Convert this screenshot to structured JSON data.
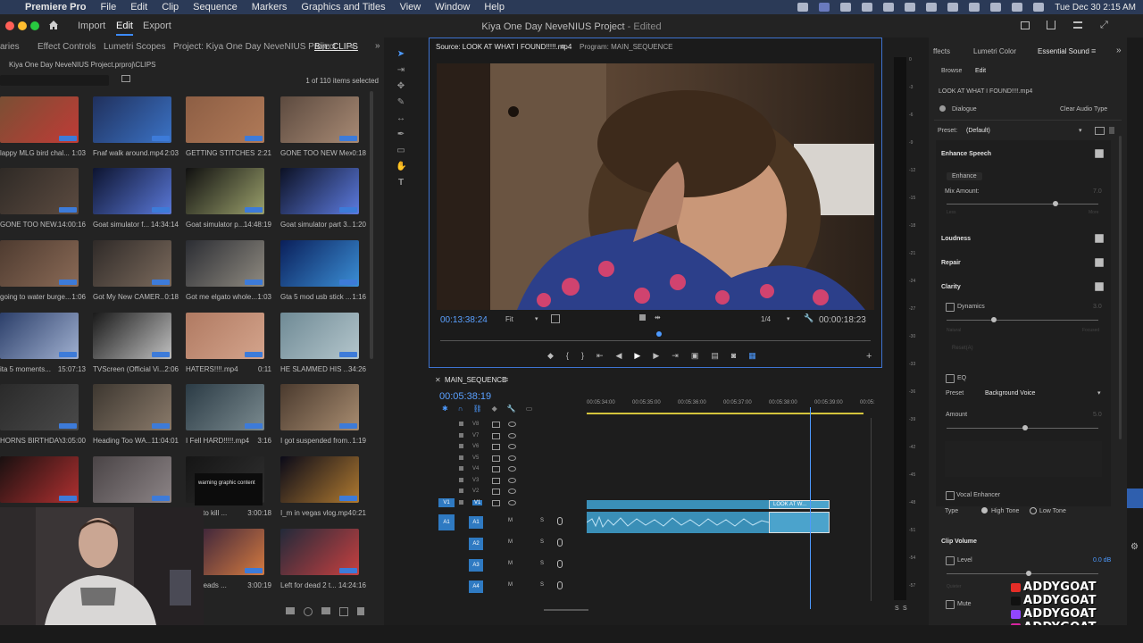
{
  "menubar": {
    "apple": "",
    "app_name": "Premiere Pro",
    "items": [
      "File",
      "Edit",
      "Clip",
      "Sequence",
      "Markers",
      "Graphics and Titles",
      "View",
      "Window",
      "Help"
    ],
    "clock": "Tue Dec 30  2:15 AM"
  },
  "header": {
    "tabs": [
      "Import",
      "Edit",
      "Export"
    ],
    "active_tab": "Edit",
    "project_title": "Kiya One Day NeveNIUS Project",
    "status": " - Edited"
  },
  "project_panel": {
    "tabs": [
      "aries",
      "Effect Controls",
      "Lumetri Scopes",
      "Project: Kiya One Day NeveNIUS Project",
      "Bin: CLIPS"
    ],
    "path": "Kiya One Day NeveNIUS Project.prproj\\CLIPS",
    "selection": "1 of 110 items selected",
    "clips": [
      {
        "name": "lappy MLG bird chal...",
        "dur": "1:03"
      },
      {
        "name": "Fnaf walk around.mp4",
        "dur": "2:03"
      },
      {
        "name": "GETTING STITCHES ...",
        "dur": "2:21"
      },
      {
        "name": "GONE TOO NEW Mex...",
        "dur": "0:18"
      },
      {
        "name": "GONE TOO NEW...",
        "dur": "14:00:16"
      },
      {
        "name": "Goat simulator f...",
        "dur": "14:34:14"
      },
      {
        "name": "Goat simulator p...",
        "dur": "14:48:19"
      },
      {
        "name": "Goat simulator part 3...",
        "dur": "1:20"
      },
      {
        "name": "going to water burge...",
        "dur": "1:06"
      },
      {
        "name": "Got My New CAMER...",
        "dur": "0:18"
      },
      {
        "name": "Got me elgato whole...",
        "dur": "1:03"
      },
      {
        "name": "Gta 5 mod usb stick ...",
        "dur": "1:16"
      },
      {
        "name": "ita 5 moments...",
        "dur": "15:07:13"
      },
      {
        "name": "TVScreen (Official Vi...",
        "dur": "2:06"
      },
      {
        "name": "HATERS!!!!.mp4",
        "dur": "0:11"
      },
      {
        "name": "HE SLAMMED HIS ...",
        "dur": "34:26"
      },
      {
        "name": "HORNS BIRTHDAY...",
        "dur": "3:05:00"
      },
      {
        "name": "Heading Too WA...",
        "dur": "11:04:01"
      },
      {
        "name": "I Fell HARD!!!!!.mp4",
        "dur": "3:16"
      },
      {
        "name": "I got suspended from...",
        "dur": "1:19"
      },
      {
        "name": "",
        "dur": ""
      },
      {
        "name": "",
        "dur": ""
      },
      {
        "name": "joing to kill ...",
        "dur": "3:00:18"
      },
      {
        "name": "I_m in vegas vlog.mp4",
        "dur": "0:21"
      },
      {
        "name": "",
        "dur": ""
      },
      {
        "name": "",
        "dur": ""
      },
      {
        "name": "gas heads ...",
        "dur": "3:00:19"
      },
      {
        "name": "Left for dead 2 t...",
        "dur": "14:24:16"
      }
    ],
    "warning_text": "warning graphic content"
  },
  "monitor": {
    "source_tab": "Source: LOOK AT WHAT I FOUND!!!!!.mp4",
    "program_tab": "Program: MAIN_SEQUENCE",
    "timecode_in": "00:13:38:24",
    "fit": "Fit",
    "resolution": "1/4",
    "duration": "00:00:18:23"
  },
  "timeline": {
    "sequence_name": "MAIN_SEQUENCE",
    "playhead": "00:05:38:19",
    "ruler": [
      "00:05:34:00",
      "00:05:35:00",
      "00:05:36:00",
      "00:05:37:00",
      "00:05:38:00",
      "00:05:39:00",
      "00:05:"
    ],
    "video_tracks": [
      "V8",
      "V7",
      "V6",
      "V5",
      "V4",
      "V3",
      "V2",
      "V1"
    ],
    "audio_tracks": [
      "A1",
      "A2",
      "A3",
      "A4"
    ],
    "source_v": "V1",
    "source_a": "A1",
    "clip_label": "LOOK AT W..."
  },
  "essential_sound": {
    "tabs": [
      "ffects",
      "Lumetri Color",
      "Essential Sound"
    ],
    "subtabs": [
      "Browse",
      "Edit"
    ],
    "clip_name": "LOOK AT WHAT I FOUND!!!!.mp4",
    "type": "Dialogue",
    "clear_button": "Clear Audio Type",
    "preset_label": "Preset:",
    "preset_value": "(Default)",
    "enhance_speech": "Enhance Speech",
    "enhance_button": "Enhance",
    "mix_amount": "Mix Amount:",
    "mix_value": "7.0",
    "less": "Less",
    "more": "More",
    "loudness": "Loudness",
    "repair": "Repair",
    "clarity": "Clarity",
    "dynamics": "Dynamics",
    "dynamics_value": "3.0",
    "natural": "Natural",
    "focused": "Focused",
    "reset": "Reset(A)",
    "eq": "EQ",
    "eq_preset_label": "Preset",
    "eq_preset_value": "Background Voice",
    "amount": "Amount",
    "amount_value": "5.0",
    "vocal_enhancer": "Vocal Enhancer",
    "type_label": "Type",
    "high_tone": "High Tone",
    "low_tone": "Low Tone",
    "clip_volume": "Clip Volume",
    "level": "Level",
    "level_value": "0.0 dB",
    "quieter": "Quieter",
    "mute": "Mute"
  },
  "meter": {
    "ticks": [
      "0",
      "-3",
      "-6",
      "-9",
      "-12",
      "-15",
      "-18",
      "-21",
      "-24",
      "-27",
      "-30",
      "-33",
      "-36",
      "-39",
      "-42",
      "-45",
      "-48",
      "-51",
      "-54",
      "-57"
    ],
    "solo_labels": [
      "S",
      "S"
    ]
  },
  "watermark": {
    "rows": [
      {
        "icon": "youtube-icon",
        "text": "ADDYGOAT",
        "color": "#e52d27"
      },
      {
        "icon": "tiktok-icon",
        "text": "ADDYGOAT",
        "color": "#111111"
      },
      {
        "icon": "twitch-icon",
        "text": "ADDYGOAT",
        "color": "#9146ff"
      },
      {
        "icon": "instagram-icon",
        "text": "ADDYGOAT",
        "color": "#d6249f"
      }
    ]
  },
  "colors": {
    "accent": "#3d8bff",
    "panel": "#232323",
    "clip_blue": "#3a8fb7"
  }
}
